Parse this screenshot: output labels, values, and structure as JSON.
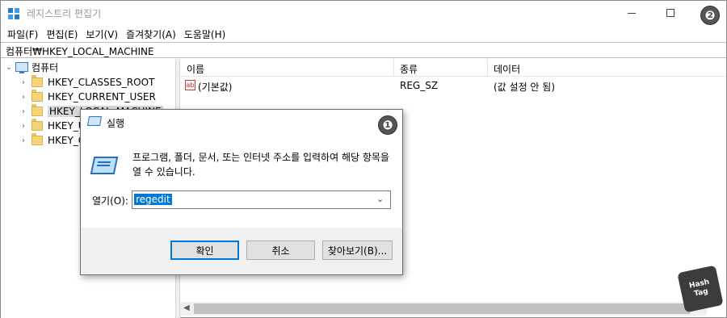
{
  "window": {
    "title": "레지스트리 편집기"
  },
  "menu": [
    "파일(F)",
    "편집(E)",
    "보기(V)",
    "즐겨찾기(A)",
    "도움말(H)"
  ],
  "address": "컴퓨터₩HKEY_LOCAL_MACHINE",
  "badges": {
    "one": "❶",
    "two": "❷"
  },
  "tree": {
    "root": "컴퓨터",
    "items": [
      "HKEY_CLASSES_ROOT",
      "HKEY_CURRENT_USER",
      "HKEY_LOCAL_MACHINE",
      "HKEY_U",
      "HKEY_C"
    ]
  },
  "list": {
    "columns": [
      "이름",
      "종류",
      "데이터"
    ],
    "rows": [
      {
        "icon": "ab",
        "name": "(기본값)",
        "type": "REG_SZ",
        "data": "(값 설정 안 됨)"
      }
    ]
  },
  "run_dialog": {
    "title": "실행",
    "description": "프로그램, 폴더, 문서, 또는 인터넷 주소를 입력하여 해당 항목을 열 수 있습니다.",
    "open_label": "열기(O):",
    "input_value": "regedit",
    "buttons": {
      "ok": "확인",
      "cancel": "취소",
      "browse": "찾아보기(B)..."
    }
  },
  "watermark": {
    "line1": "Hash",
    "line2": "Tag"
  },
  "colors": {
    "accent": "#0078d7",
    "badge": "#555555",
    "folder": "#f5d479"
  }
}
